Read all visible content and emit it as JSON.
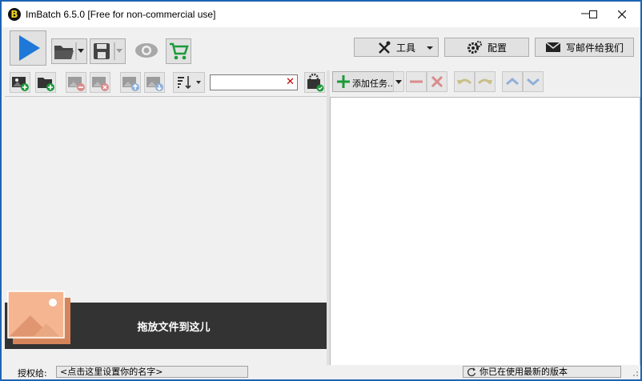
{
  "window": {
    "title": "ImBatch 6.5.0 [Free for non-commercial use]",
    "app_icon_letter": "B"
  },
  "toolbar": {
    "tools_label": "工具",
    "settings_label": "配置",
    "email_label": "写邮件给我们"
  },
  "tasks": {
    "add_task_label": "添加任务..."
  },
  "filter": {
    "value": ""
  },
  "drop_zone": {
    "label": "拖放文件到这儿"
  },
  "status": {
    "licensed_to_label": "授权给:",
    "licensed_to_value": "<点击这里设置你的名字>",
    "version_status": "你已在使用最新的版本"
  },
  "colors": {
    "accent_blue": "#1e78d7",
    "green": "#1a9a3a",
    "red": "#c0392b",
    "window_border": "#1e64b4"
  }
}
